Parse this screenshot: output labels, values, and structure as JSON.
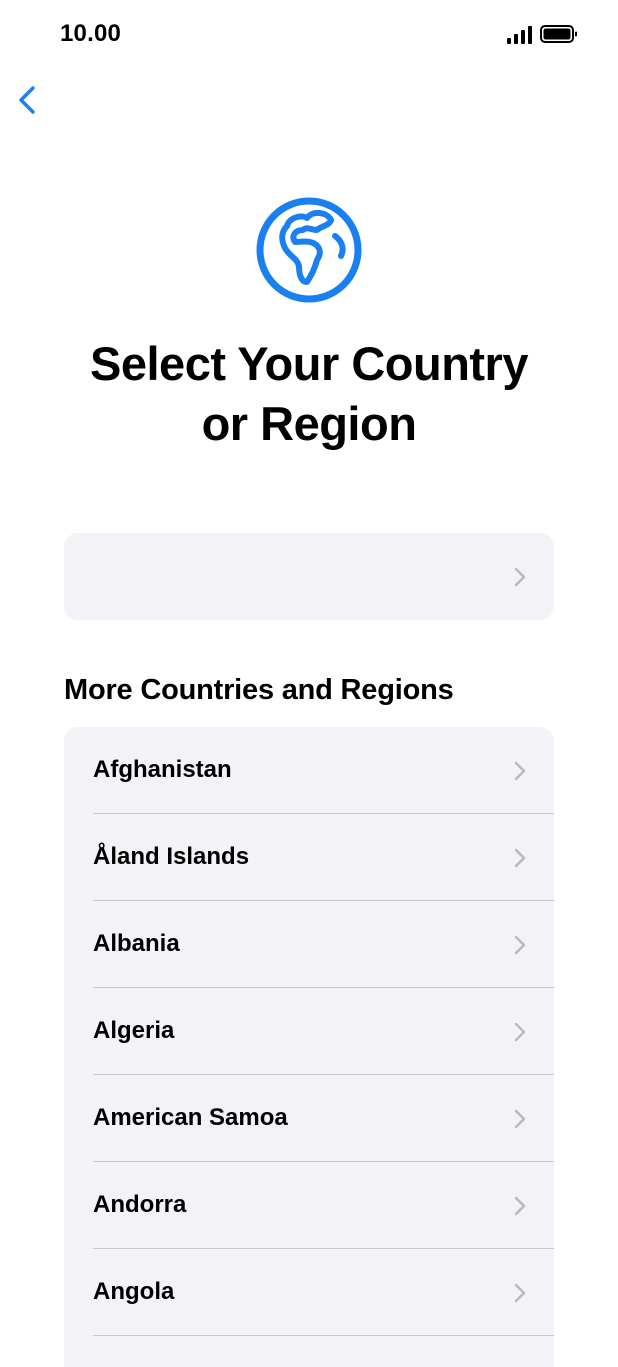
{
  "status_bar": {
    "time": "10.00",
    "signal_icon": "cellular-signal-icon",
    "battery_icon": "battery-full-icon"
  },
  "navigation": {
    "back_icon": "chevron-left-icon",
    "accent_color": "#1a7ff0"
  },
  "header": {
    "icon": "globe-icon",
    "title_line1": "Select Your Country",
    "title_line2": "or Region"
  },
  "suggested_region": {
    "label": "",
    "chevron_icon": "chevron-right-icon"
  },
  "more_section": {
    "heading": "More Countries and Regions",
    "items": [
      {
        "label": "Afghanistan"
      },
      {
        "label": "Åland Islands"
      },
      {
        "label": "Albania"
      },
      {
        "label": "Algeria"
      },
      {
        "label": "American Samoa"
      },
      {
        "label": "Andorra"
      },
      {
        "label": "Angola"
      }
    ]
  },
  "colors": {
    "card_background": "#f2f2f7",
    "separator": "#c8c8cc",
    "chevron": "#b8b8bd"
  }
}
